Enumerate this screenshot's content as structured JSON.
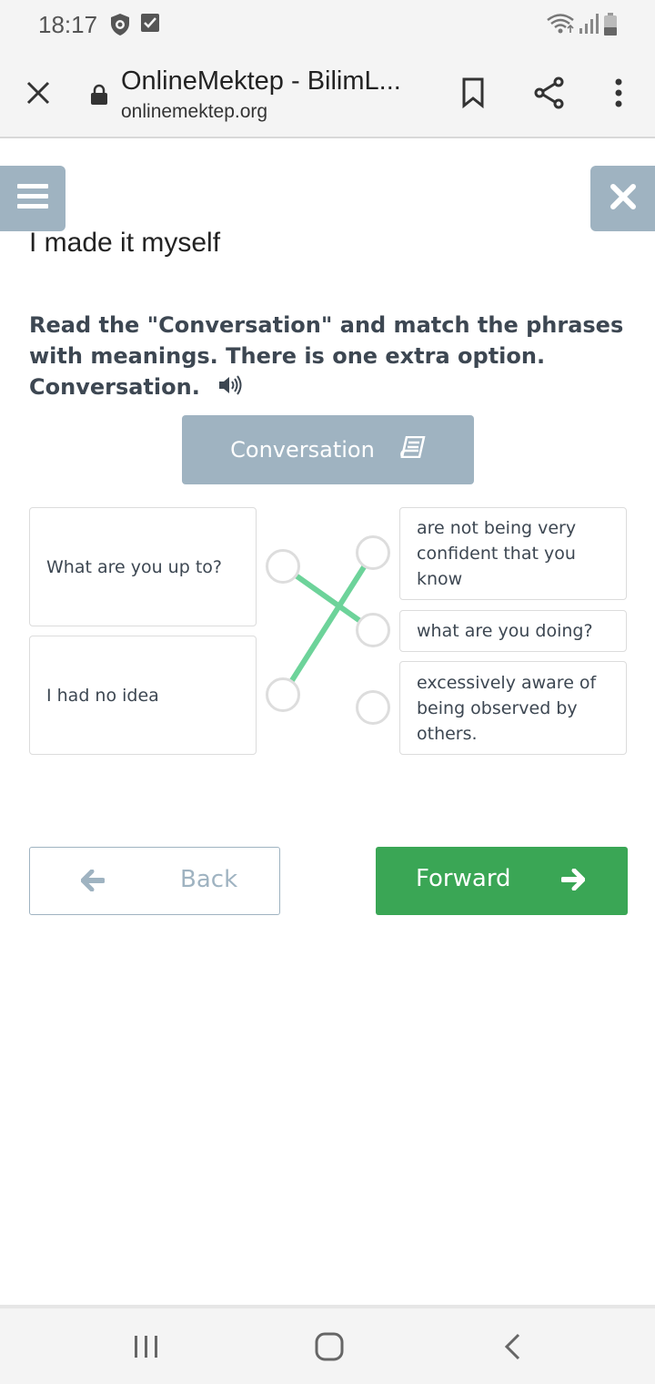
{
  "status_bar": {
    "time": "18:17",
    "icons": [
      "shield-lion-icon",
      "check-box-icon",
      "wifi-icon",
      "signal-icon",
      "battery-icon"
    ]
  },
  "browser": {
    "page_title": "OnlineMektep - BilimL...",
    "url": "onlinemektep.org",
    "icons": [
      "close-icon",
      "lock-icon",
      "bookmark-icon",
      "share-icon",
      "more-vert-icon"
    ]
  },
  "lesson": {
    "title": "I made it myself",
    "task_lines": [
      "Read the \"Conversation\" and match the phrases",
      "with meanings. There is one extra option.",
      "Conversation."
    ],
    "conversation_button": "Conversation"
  },
  "matching": {
    "left": [
      "What are you up to?",
      "I had no idea"
    ],
    "right": [
      "are not being very confident that you know",
      "what are you doing?",
      "excessively aware of being observed by others."
    ],
    "connections": [
      {
        "from": "What are you up to?",
        "to": "what are you doing?"
      },
      {
        "from": "I had no idea",
        "to": "are not being very confident that you know"
      }
    ],
    "line_color": "#6dd39a"
  },
  "navigation": {
    "back": "Back",
    "forward": "Forward"
  },
  "colors": {
    "accent": "#9fb3c1",
    "forward": "#3aa655"
  },
  "system_nav": [
    "recent-apps-icon",
    "home-icon",
    "back-icon"
  ]
}
